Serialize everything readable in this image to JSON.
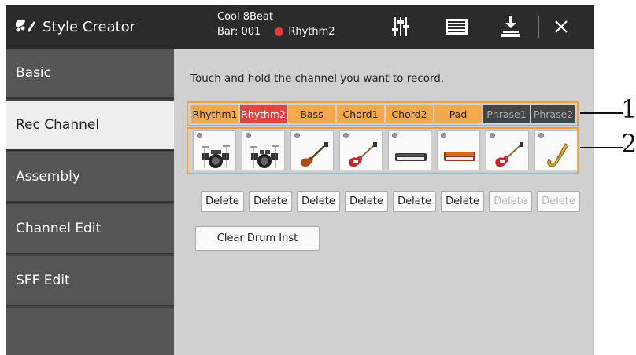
{
  "app": {
    "title": "Style Creator"
  },
  "song": {
    "name": "Cool 8Beat",
    "bar": "Bar: 001",
    "rec_channel": "Rhythm2"
  },
  "sidebar": {
    "items": [
      {
        "label": "Basic",
        "active": false
      },
      {
        "label": "Rec Channel",
        "active": true
      },
      {
        "label": "Assembly",
        "active": false
      },
      {
        "label": "Channel Edit",
        "active": false
      },
      {
        "label": "SFF Edit",
        "active": false
      }
    ]
  },
  "main": {
    "instruction": "Touch and hold the channel you want to record.",
    "channels": [
      {
        "label": "Rhythm1",
        "state": "available",
        "instrument": "drum-kit"
      },
      {
        "label": "Rhythm2",
        "state": "selected",
        "instrument": "drum-kit"
      },
      {
        "label": "Bass",
        "state": "available",
        "instrument": "bass-guitar"
      },
      {
        "label": "Chord1",
        "state": "available",
        "instrument": "electric-guitar"
      },
      {
        "label": "Chord2",
        "state": "available",
        "instrument": "keyboard"
      },
      {
        "label": "Pad",
        "state": "available",
        "instrument": "synth-keyboard"
      },
      {
        "label": "Phrase1",
        "state": "disabled",
        "instrument": "electric-guitar"
      },
      {
        "label": "Phrase2",
        "state": "disabled",
        "instrument": "saxophone"
      }
    ],
    "delete_labels": [
      "Delete",
      "Delete",
      "Delete",
      "Delete",
      "Delete",
      "Delete",
      "Delete",
      "Delete"
    ],
    "clear_drum_label": "Clear Drum Inst"
  },
  "callouts": {
    "one": "1",
    "two": "2"
  },
  "colors": {
    "accent": "#f0a030",
    "channel": "#f2a94a",
    "selected": "#e8423e",
    "disabled": "#444444",
    "record": "#e53b3b"
  }
}
